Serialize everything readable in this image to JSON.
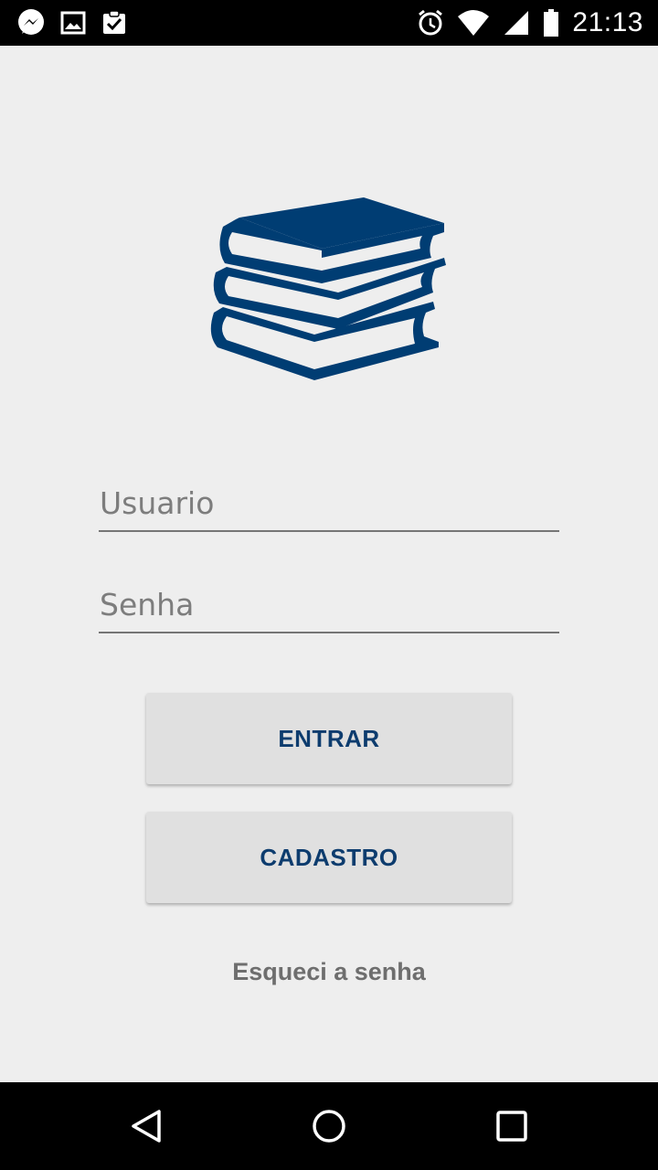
{
  "status_bar": {
    "time": "21:13",
    "left_icons": [
      "messenger-icon",
      "image-icon",
      "clipboard-check-icon"
    ],
    "right_icons": [
      "alarm-icon",
      "wifi-icon",
      "signal-icon",
      "battery-icon"
    ]
  },
  "logo": {
    "icon": "books-stack-icon",
    "color": "#003d73"
  },
  "login": {
    "username_placeholder": "Usuario",
    "username_value": "",
    "password_placeholder": "Senha",
    "password_value": "",
    "enter_label": "ENTRAR",
    "signup_label": "CADASTRO",
    "forgot_label": "Esqueci a senha"
  },
  "colors": {
    "accent": "#0d3c6e",
    "background": "#eeeeee",
    "button_bg": "#e0e0e0"
  },
  "nav_bar": {
    "icons": [
      "back-icon",
      "home-icon",
      "recents-icon"
    ]
  }
}
